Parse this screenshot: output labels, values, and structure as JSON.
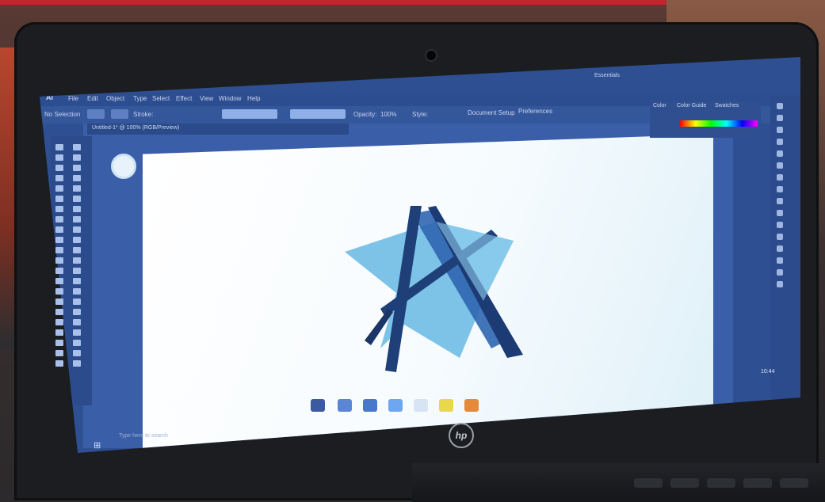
{
  "window": {
    "app_logo": "Ai",
    "document_tab": "Untitled-1* @ 100% (RGB/Preview)",
    "user_label": "Essentials"
  },
  "menu": {
    "items": [
      "File",
      "Edit",
      "Object",
      "Type",
      "Select",
      "Effect",
      "View",
      "Window",
      "Help"
    ]
  },
  "control_bar": {
    "selection_label": "No Selection",
    "stroke_label": "Stroke:",
    "opacity_label": "Opacity:",
    "opacity_value": "100%",
    "style_label": "Style:",
    "document_setup": "Document Setup",
    "preferences": "Preferences"
  },
  "panels": {
    "color_title": "Color",
    "color_guide": "Color Guide",
    "swatches": "Swatches"
  },
  "taskbar": {
    "search_placeholder": "Type here to search",
    "clock": "10:44"
  },
  "laptop": {
    "brand": "hp"
  },
  "colors": {
    "screen_blue": "#2e4f92",
    "logo_light": "#5cb4e0",
    "logo_dark": "#1e3f78"
  },
  "icons": [
    "start-icon",
    "search-icon",
    "task-view-icon",
    "explorer-icon",
    "store-icon",
    "mail-icon",
    "chrome-icon",
    "illustrator-icon"
  ]
}
